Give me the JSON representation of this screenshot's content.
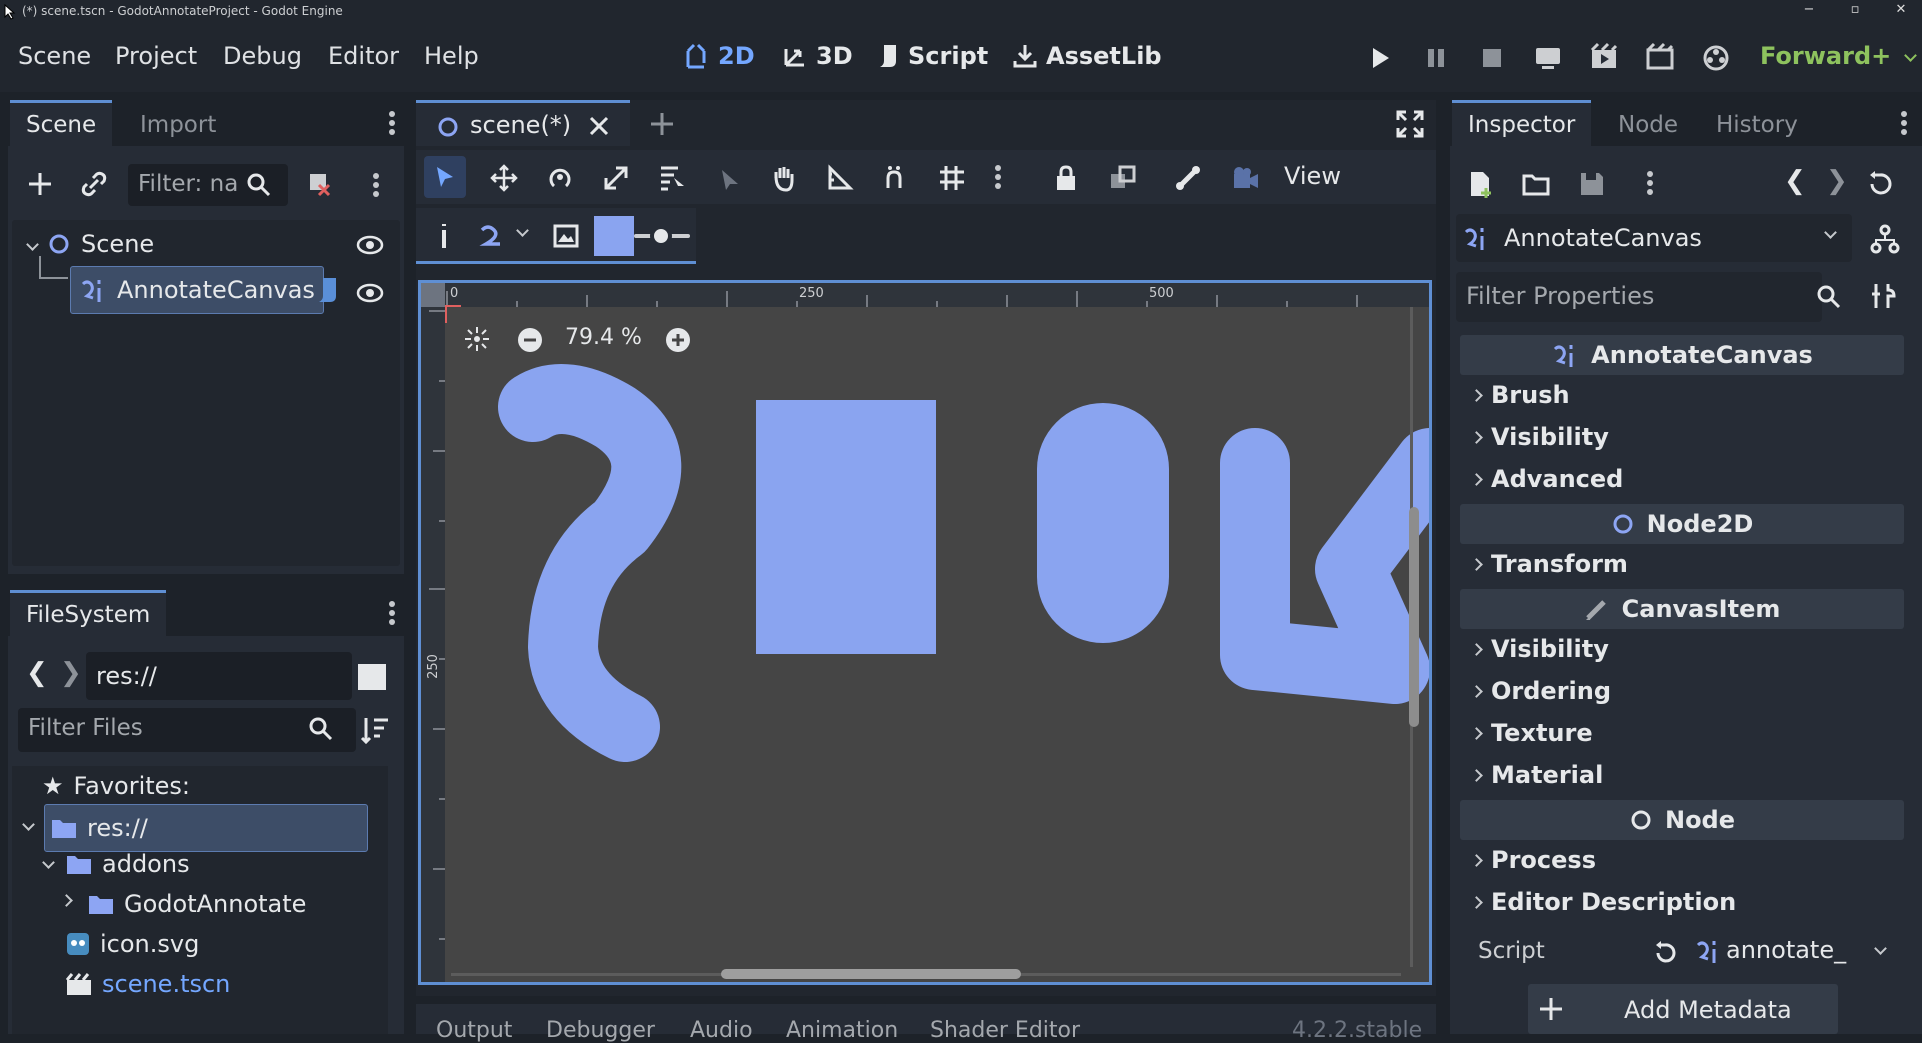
{
  "window": {
    "title": "(*) scene.tscn - GodotAnnotateProject - Godot Engine",
    "minimize": "−",
    "maximize": "▫",
    "close": "✕"
  },
  "menu": {
    "scene": "Scene",
    "project": "Project",
    "debug": "Debug",
    "editor": "Editor",
    "help": "Help"
  },
  "workspaces": {
    "w2d": "2D",
    "w3d": "3D",
    "script": "Script",
    "assetlib": "AssetLib"
  },
  "renderer": "Forward+",
  "scene_dock": {
    "tab_scene": "Scene",
    "tab_import": "Import",
    "filter_placeholder": "Filter: na",
    "tree": {
      "root": "Scene",
      "child": "AnnotateCanvas"
    }
  },
  "filesystem": {
    "tab": "FileSystem",
    "path": "res://",
    "filter_placeholder": "Filter Files",
    "favorites": "Favorites:",
    "items": {
      "res": "res://",
      "addons": "addons",
      "godotannotate": "GodotAnnotate",
      "icon": "icon.svg",
      "scene": "scene.tscn"
    }
  },
  "editor": {
    "scene_tab": "scene(*)",
    "view_label": "View",
    "zoom": "79.4 %",
    "ruler_top": [
      "0",
      "250",
      "500"
    ],
    "ruler_left": [
      "250"
    ],
    "brush_color": "#8aa4f0"
  },
  "inspector": {
    "tab_inspector": "Inspector",
    "tab_node": "Node",
    "tab_history": "History",
    "node_name": "AnnotateCanvas",
    "filter_placeholder": "Filter Properties",
    "sections": {
      "annotate": "AnnotateCanvas",
      "node2d": "Node2D",
      "canvasitem": "CanvasItem",
      "node": "Node"
    },
    "props": {
      "brush": "Brush",
      "visibility1": "Visibility",
      "advanced": "Advanced",
      "transform": "Transform",
      "visibility2": "Visibility",
      "ordering": "Ordering",
      "texture": "Texture",
      "material": "Material",
      "process": "Process",
      "editor_description": "Editor Description"
    },
    "script_label": "Script",
    "script_value": "annotate_",
    "add_metadata": "Add Metadata"
  },
  "bottom_panel": {
    "output": "Output",
    "debugger": "Debugger",
    "audio": "Audio",
    "animation": "Animation",
    "shader": "Shader Editor",
    "version": "4.2.2.stable"
  }
}
